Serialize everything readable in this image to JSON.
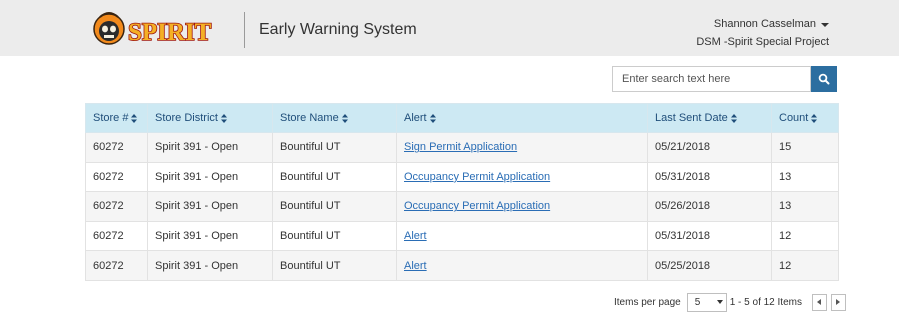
{
  "header": {
    "logo_text": "SPIRIT",
    "app_title": "Early Warning System",
    "user_name": "Shannon Casselman",
    "user_role": "DSM -Spirit Special Project"
  },
  "search": {
    "placeholder": "Enter search text here",
    "icon": "search-icon"
  },
  "table": {
    "columns": [
      "Store #",
      "Store District",
      "Store Name",
      "Alert",
      "Last Sent Date",
      "Count"
    ],
    "rows": [
      {
        "store_num": "60272",
        "district": "Spirit 391 - Open",
        "name": "Bountiful UT",
        "alert": "Sign Permit Application",
        "date": "05/21/2018",
        "count": "15"
      },
      {
        "store_num": "60272",
        "district": "Spirit 391 - Open",
        "name": "Bountiful UT",
        "alert": "Occupancy Permit Application",
        "date": "05/31/2018",
        "count": "13"
      },
      {
        "store_num": "60272",
        "district": "Spirit 391 - Open",
        "name": "Bountiful UT",
        "alert": "Occupancy Permit Application",
        "date": "05/26/2018",
        "count": "13"
      },
      {
        "store_num": "60272",
        "district": "Spirit 391 - Open",
        "name": "Bountiful UT",
        "alert": "Alert",
        "date": "05/31/2018",
        "count": "12"
      },
      {
        "store_num": "60272",
        "district": "Spirit 391 - Open",
        "name": "Bountiful UT",
        "alert": "Alert",
        "date": "05/25/2018",
        "count": "12"
      }
    ]
  },
  "pager": {
    "items_per_page_label": "Items per page",
    "page_size": "5",
    "range_text": "1 - 5 of 12 Items"
  },
  "colors": {
    "header_bg": "#ececec",
    "table_header_bg": "#cde9f3",
    "table_header_text": "#1f4e7a",
    "link": "#2a6db5",
    "search_button": "#2c6ea0"
  }
}
